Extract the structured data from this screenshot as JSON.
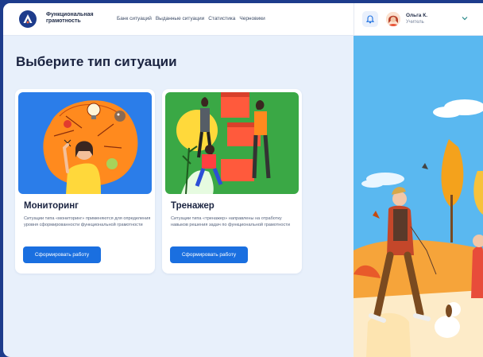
{
  "header": {
    "brand_line1": "Функциональная",
    "brand_line2": "грамотность",
    "nav": [
      "Банк ситуаций",
      "Выданные ситуации",
      "Статистика",
      "Черновики"
    ],
    "user": {
      "name": "Ольга К.",
      "role": "Учитель"
    }
  },
  "page": {
    "title": "Выберите тип ситуации"
  },
  "cards": [
    {
      "title": "Мониторинг",
      "description": "Ситуации типа «мониторинг» применяются для определения уровня сформированности функциональной грамотности",
      "button": "Сформировать работу"
    },
    {
      "title": "Тренажер",
      "description": "Ситуации типа «тренажер» направлены на отработку навыков решения задач по функциональной грамотности",
      "button": "Сформировать работу"
    }
  ],
  "colors": {
    "accent": "#1a6fe0",
    "card1_bg": "#2b7de9",
    "card2_bg": "#3aa845",
    "sky": "#5ab8f0"
  },
  "icons": [
    "logo-icon",
    "bell-icon",
    "chevron-down-icon"
  ]
}
